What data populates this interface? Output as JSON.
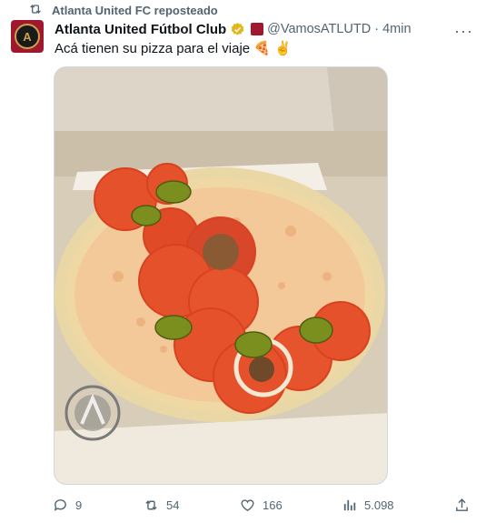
{
  "repost": {
    "label": "Atlanta United FC reposteado",
    "icon": "repost-icon"
  },
  "post": {
    "author_name": "Atlanta United Fútbol Club",
    "handle": "@VamosATLUTD",
    "separator": "·",
    "time": "4min",
    "text": "Acá tienen su pizza para el viaje 🍕 ✌️",
    "more": "···",
    "image_alt": "Pizza with tomato slices and olives in a box"
  },
  "actions": {
    "replies": "9",
    "reposts": "54",
    "likes": "166",
    "views": "5.098"
  },
  "colors": {
    "accent": "#1d9bf0",
    "muted": "#536471",
    "brand": "#a0182f",
    "verified": "#e2b719"
  }
}
